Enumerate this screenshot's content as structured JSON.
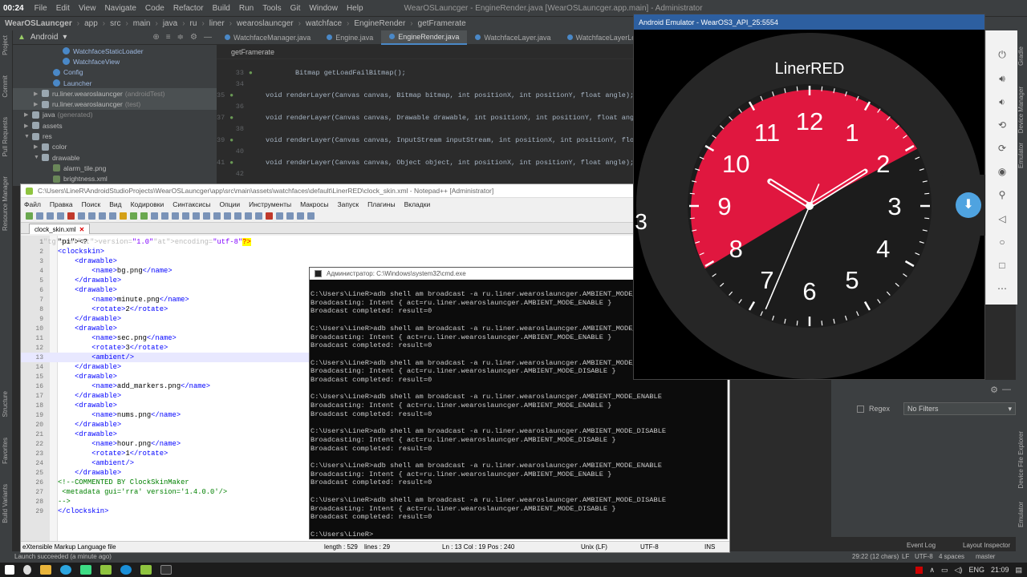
{
  "ide": {
    "clock": "00:24",
    "menu": [
      "File",
      "Edit",
      "View",
      "Navigate",
      "Code",
      "Refactor",
      "Build",
      "Run",
      "Tools",
      "Git",
      "Window",
      "Help"
    ],
    "window_title": "WearOSLauncger - EngineRender.java [WearOSLauncger.app.main] - Administrator",
    "breadcrumb": [
      "WearOSLauncger",
      "app",
      "src",
      "main",
      "java",
      "ru",
      "liner",
      "wearoslauncger",
      "watchface",
      "EngineRender",
      "getFramerate"
    ],
    "project_view": "Android",
    "tree": [
      {
        "label": "WatchfaceStaticLoader",
        "sub": ""
      },
      {
        "label": "WatchfaceView",
        "sub": ""
      },
      {
        "label": "Config",
        "sub": ""
      },
      {
        "label": "Launcher",
        "sub": ""
      },
      {
        "label": "ru.liner.wearoslauncger",
        "sub": "(androidTest)"
      },
      {
        "label": "ru.liner.wearoslauncger",
        "sub": "(test)"
      },
      {
        "label": "java",
        "sub": "(generated)"
      },
      {
        "label": "assets",
        "sub": ""
      },
      {
        "label": "res",
        "sub": ""
      },
      {
        "label": "color",
        "sub": ""
      },
      {
        "label": "drawable",
        "sub": ""
      },
      {
        "label": "alarm_tile.png",
        "sub": ""
      },
      {
        "label": "brightness.xml",
        "sub": ""
      }
    ],
    "tabs": [
      "WatchfaceManager.java",
      "Engine.java",
      "EngineRender.java",
      "WatchfaceLayer.java",
      "WatchfaceLayerLoader.java"
    ],
    "active_tab": "EngineRender.java",
    "method_crumb": "getFramerate",
    "code": [
      {
        "ln": "33",
        "text": "Bitmap getLoadFailBitmap();"
      },
      {
        "ln": "34",
        "text": ""
      },
      {
        "ln": "35",
        "text": "void renderLayer(Canvas canvas, Bitmap bitmap, int positionX, int positionY, float angle);"
      },
      {
        "ln": "36",
        "text": ""
      },
      {
        "ln": "37",
        "text": "void renderLayer(Canvas canvas, Drawable drawable, int positionX, int positionY, float angle);"
      },
      {
        "ln": "38",
        "text": ""
      },
      {
        "ln": "39",
        "text": "void renderLayer(Canvas canvas, InputStream inputStream, int positionX, int positionY, float angle);"
      },
      {
        "ln": "40",
        "text": ""
      },
      {
        "ln": "41",
        "text": "void renderLayer(Canvas canvas, Object object, int positionX, int positionY, float angle);"
      },
      {
        "ln": "42",
        "text": ""
      }
    ],
    "status_left": "Launch succeeded (a minute ago)",
    "status_right": [
      "29:22 (12 chars)",
      "LF",
      "UTF-8",
      "4 spaces",
      "master"
    ],
    "bottom_tools": [
      "Event Log",
      "Layout Inspector"
    ],
    "left_strip": [
      "Project",
      "Commit",
      "Pull Requests",
      "Resource Manager",
      "Structure",
      "Favorites",
      "Build Variants"
    ],
    "right_strip": [
      "Gradle",
      "Device Manager",
      "Emulator",
      "Device File Explorer",
      "Emulator"
    ],
    "logcat": {
      "regex_label": "Regex",
      "filter": "No Filters"
    }
  },
  "npp": {
    "title": "C:\\Users\\LineR\\AndroidStudioProjects\\WearOSLauncger\\app\\src\\main\\assets\\watchfaces\\default\\LinerRED\\clock_skin.xml - Notepad++ [Administrator]",
    "menu": [
      "Файл",
      "Правка",
      "Поиск",
      "Вид",
      "Кодировки",
      "Синтаксисы",
      "Опции",
      "Инструменты",
      "Макросы",
      "Запуск",
      "Плагины",
      "Вкладки"
    ],
    "tab": "clock_skin.xml",
    "lines": [
      "<?xml version=\"1.0\" encoding=\"utf-8\"?>",
      "<clockskin>",
      "    <drawable>",
      "        <name>bg.png</name>",
      "    </drawable>",
      "    <drawable>",
      "        <name>minute.png</name>",
      "        <rotate>2</rotate>",
      "    </drawable>",
      "    <drawable>",
      "        <name>sec.png</name>",
      "        <rotate>3</rotate>",
      "        <ambient/>",
      "    </drawable>",
      "    <drawable>",
      "        <name>add_markers.png</name>",
      "    </drawable>",
      "    <drawable>",
      "        <name>nums.png</name>",
      "    </drawable>",
      "    <drawable>",
      "        <name>hour.png</name>",
      "        <rotate>1</rotate>",
      "        <ambient/>",
      "    </drawable>",
      "<!--COMMENTED BY ClockSkinMaker",
      " <metadata gui='rra' version='1.4.0.0'/>",
      "-->",
      "</clockskin>"
    ],
    "status": {
      "filetype": "eXtensible Markup Language file",
      "length": "length : 529",
      "lines": "lines : 29",
      "pos": "Ln : 13    Col : 19    Pos : 240",
      "eol": "Unix (LF)",
      "enc": "UTF-8",
      "mode": "INS"
    }
  },
  "cmd": {
    "title": "Администратор: C:\\Windows\\system32\\cmd.exe",
    "lines": [
      "C:\\Users\\LineR>adb shell am broadcast -a ru.liner.wearoslauncger.AMBIENT_MODE_ENABLE",
      "Broadcasting: Intent { act=ru.liner.wearoslauncger.AMBIENT_MODE_ENABLE }",
      "Broadcast completed: result=0",
      "",
      "C:\\Users\\LineR>adb shell am broadcast -a ru.liner.wearoslauncger.AMBIENT_MODE_ENABLE",
      "Broadcasting: Intent { act=ru.liner.wearoslauncger.AMBIENT_MODE_ENABLE }",
      "Broadcast completed: result=0",
      "",
      "C:\\Users\\LineR>adb shell am broadcast -a ru.liner.wearoslauncger.AMBIENT_MODE_DISABLE",
      "Broadcasting: Intent { act=ru.liner.wearoslauncger.AMBIENT_MODE_DISABLE }",
      "Broadcast completed: result=0",
      "",
      "C:\\Users\\LineR>adb shell am broadcast -a ru.liner.wearoslauncger.AMBIENT_MODE_ENABLE",
      "Broadcasting: Intent { act=ru.liner.wearoslauncger.AMBIENT_MODE_ENABLE }",
      "Broadcast completed: result=0",
      "",
      "C:\\Users\\LineR>adb shell am broadcast -a ru.liner.wearoslauncger.AMBIENT_MODE_DISABLE",
      "Broadcasting: Intent { act=ru.liner.wearoslauncger.AMBIENT_MODE_DISABLE }",
      "Broadcast completed: result=0",
      "",
      "C:\\Users\\LineR>adb shell am broadcast -a ru.liner.wearoslauncger.AMBIENT_MODE_ENABLE",
      "Broadcasting: Intent { act=ru.liner.wearoslauncger.AMBIENT_MODE_ENABLE }",
      "Broadcast completed: result=0",
      "",
      "C:\\Users\\LineR>adb shell am broadcast -a ru.liner.wearoslauncger.AMBIENT_MODE_DISABLE",
      "Broadcasting: Intent { act=ru.liner.wearoslauncger.AMBIENT_MODE_DISABLE }",
      "Broadcast completed: result=0",
      "",
      "C:\\Users\\LineR>"
    ]
  },
  "emulator": {
    "title": "Android Emulator - WearOS3_API_25:5554",
    "brand": "LinerRED",
    "accent": "#e0173f",
    "dial_numbers": [
      "12",
      "1",
      "2",
      "3",
      "4",
      "5",
      "6",
      "7",
      "8",
      "9",
      "10",
      "11"
    ],
    "edge_label": "3",
    "side_icons": [
      "power-icon",
      "volume-up-icon",
      "volume-down-icon",
      "rotate-left-icon",
      "rotate-right-icon",
      "camera-icon",
      "zoom-icon",
      "back-icon",
      "home-icon",
      "overview-icon",
      "more-icon"
    ]
  },
  "taskbar": {
    "lang": "ENG",
    "time": "21:09"
  }
}
